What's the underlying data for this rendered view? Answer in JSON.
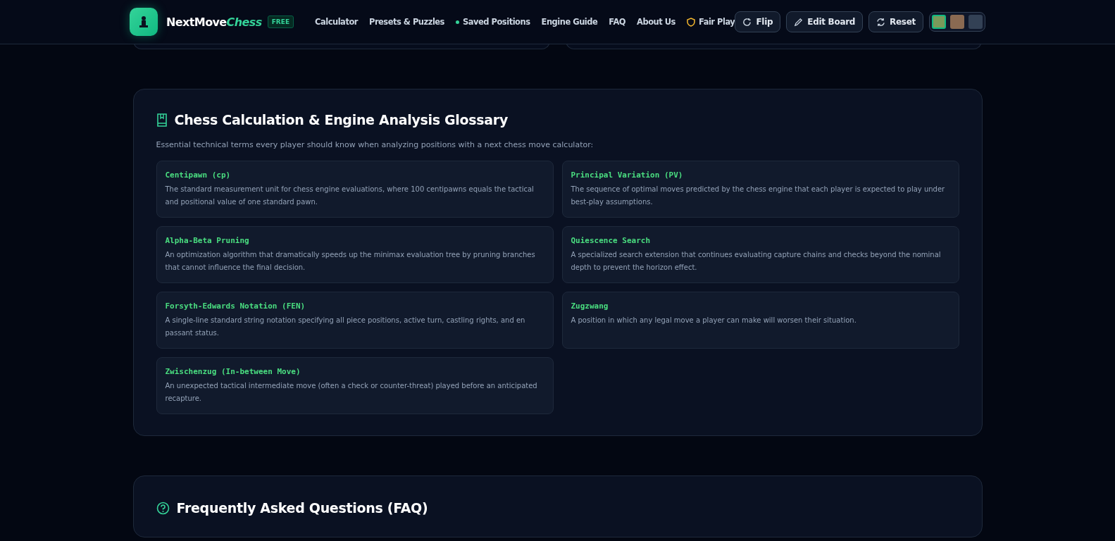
{
  "header": {
    "brand_first": "NextMove",
    "brand_second": "Chess",
    "badge": "FREE",
    "nav": [
      {
        "label": "Calculator",
        "kind": "plain"
      },
      {
        "label": "Presets & Puzzles",
        "kind": "plain"
      },
      {
        "label": "Saved Positions",
        "kind": "dot"
      },
      {
        "label": "Engine Guide",
        "kind": "plain"
      },
      {
        "label": "FAQ",
        "kind": "plain"
      },
      {
        "label": "About Us",
        "kind": "plain"
      },
      {
        "label": "Fair Play",
        "kind": "shield"
      }
    ],
    "buttons": [
      {
        "label": "Flip",
        "kind": "flip"
      },
      {
        "label": "Edit Board",
        "kind": "edit"
      },
      {
        "label": "Reset",
        "kind": "reset"
      }
    ],
    "themes": [
      {
        "color": "#7a9a5a",
        "selected": true
      },
      {
        "color": "#8a6a52",
        "selected": false
      },
      {
        "color": "#334155",
        "selected": false
      }
    ]
  },
  "glossary": {
    "title": "Chess Calculation & Engine Analysis Glossary",
    "intro": "Essential technical terms every player should know when analyzing positions with a next chess move calculator:",
    "terms": [
      {
        "term": "Centipawn (cp)",
        "text": "The standard measurement unit for chess engine evaluations, where 100 centipawns equals the tactical and positional value of one standard pawn."
      },
      {
        "term": "Principal Variation (PV)",
        "text": "The sequence of optimal moves predicted by the chess engine that each player is expected to play under best-play assumptions."
      },
      {
        "term": "Alpha-Beta Pruning",
        "text": "An optimization algorithm that dramatically speeds up the minimax evaluation tree by pruning branches that cannot influence the final decision."
      },
      {
        "term": "Quiescence Search",
        "text": "A specialized search extension that continues evaluating capture chains and checks beyond the nominal depth to prevent the horizon effect."
      },
      {
        "term": "Forsyth-Edwards Notation (FEN)",
        "text": "A single-line standard string notation specifying all piece positions, active turn, castling rights, and en passant status."
      },
      {
        "term": "Zugzwang",
        "text": "A position in which any legal move a player can make will worsen their situation."
      },
      {
        "term": "Zwischenzug (In-between Move)",
        "text": "An unexpected tactical intermediate move (often a check or counter-threat) played before an anticipated recapture."
      }
    ]
  },
  "faq": {
    "title": "Frequently Asked Questions (FAQ)"
  }
}
